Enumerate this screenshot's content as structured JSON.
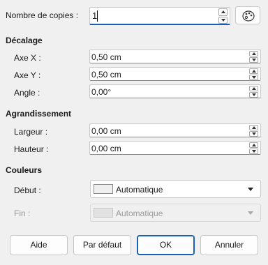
{
  "copies": {
    "label": "Nombre de copies :",
    "value": "1"
  },
  "sections": {
    "offset": "Décalage",
    "enlargement": "Agrandissement",
    "colors": "Couleurs"
  },
  "offset": {
    "x_label": "Axe X :",
    "x_value": "0,50 cm",
    "y_label": "Axe Y :",
    "y_value": "0,50 cm",
    "angle_label": "Angle :",
    "angle_value": "0,00°"
  },
  "enlargement": {
    "width_label": "Largeur :",
    "width_value": "0,00 cm",
    "height_label": "Hauteur :",
    "height_value": "0,00 cm"
  },
  "colors": {
    "start_label": "Début :",
    "start_value": "Automatique",
    "end_label": "Fin :",
    "end_value": "Automatique",
    "swatch_color": "#efefef",
    "accent_color": "#1a5fb4"
  },
  "buttons": {
    "help": "Aide",
    "default": "Par défaut",
    "ok": "OK",
    "cancel": "Annuler"
  }
}
